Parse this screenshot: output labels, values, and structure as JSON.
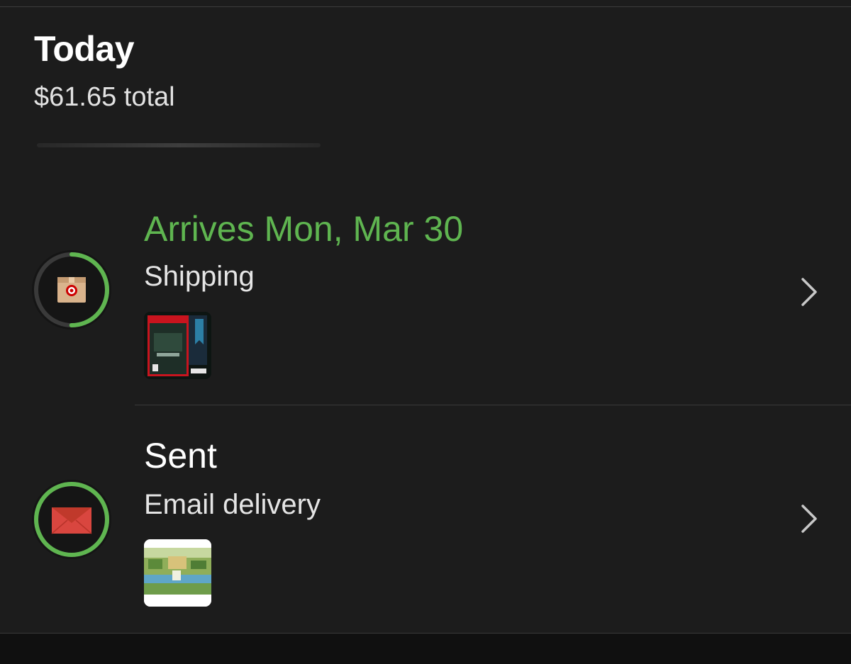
{
  "header": {
    "title": "Today",
    "total": "$61.65 total"
  },
  "orders": [
    {
      "status": "Arrives Mon, Mar 30",
      "method": "Shipping",
      "status_color": "#5fb550",
      "progress": 0.5,
      "icon": "target-box-icon"
    },
    {
      "status": "Sent",
      "method": "Email delivery",
      "status_color": "#ffffff",
      "progress": 1.0,
      "icon": "envelope-icon"
    }
  ],
  "colors": {
    "background": "#1c1c1c",
    "accent_green": "#5fb550",
    "ring_track": "#3a3a3a",
    "target_red": "#cc0000",
    "envelope_red": "#d9463f"
  }
}
